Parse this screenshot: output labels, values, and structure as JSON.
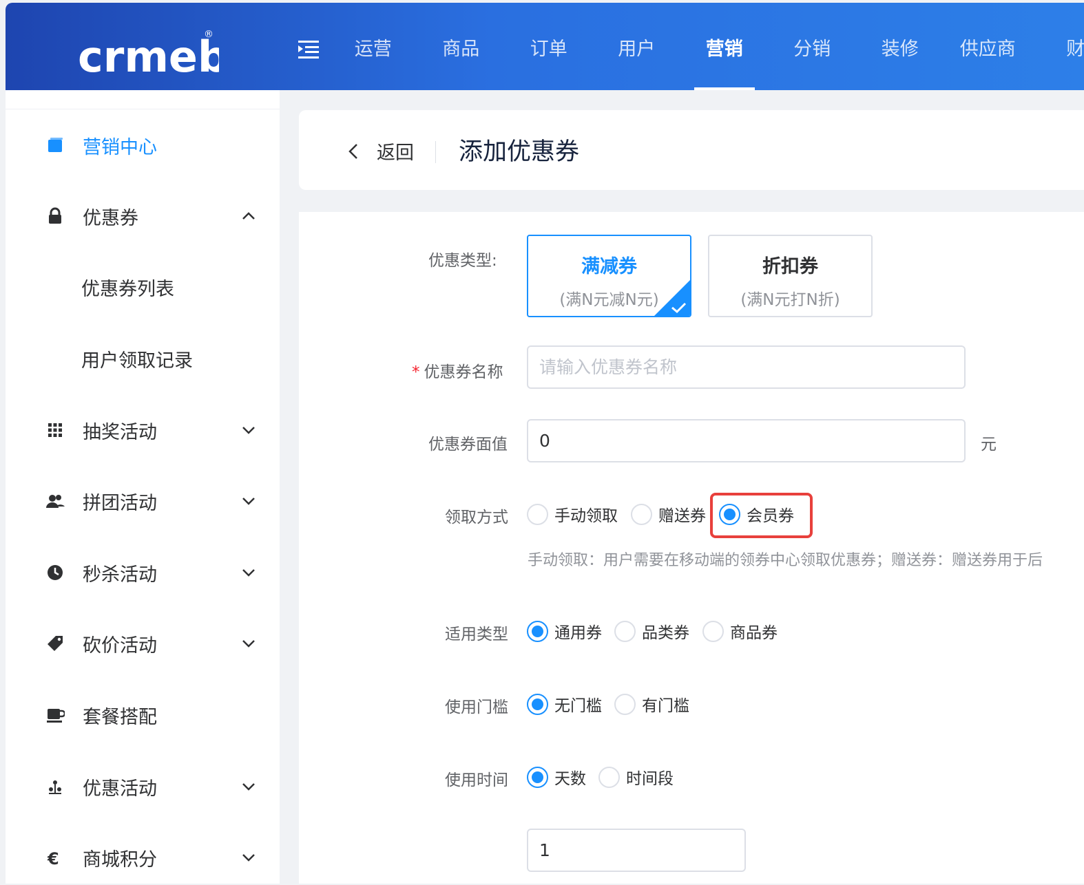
{
  "brand": {
    "logo_text": "crmeb",
    "logo_mark": "®"
  },
  "top_nav": [
    {
      "label": "运营",
      "active": false
    },
    {
      "label": "商品",
      "active": false
    },
    {
      "label": "订单",
      "active": false
    },
    {
      "label": "用户",
      "active": false
    },
    {
      "label": "营销",
      "active": true
    },
    {
      "label": "分销",
      "active": false
    },
    {
      "label": "装修",
      "active": false
    },
    {
      "label": "供应商",
      "active": false
    },
    {
      "label": "财",
      "active": false
    }
  ],
  "sidebar": {
    "items": [
      {
        "label": "营销中心",
        "icon": "square-stack-icon",
        "active": true
      },
      {
        "label": "优惠券",
        "icon": "lock-icon",
        "expanded": true
      },
      {
        "label": "优惠券列表",
        "sub": true
      },
      {
        "label": "用户领取记录",
        "sub": true
      },
      {
        "label": "抽奖活动",
        "icon": "grid-icon"
      },
      {
        "label": "拼团活动",
        "icon": "users-icon"
      },
      {
        "label": "秒杀活动",
        "icon": "clock-icon"
      },
      {
        "label": "砍价活动",
        "icon": "tag-icon"
      },
      {
        "label": "套餐搭配",
        "icon": "cup-icon"
      },
      {
        "label": "优惠活动",
        "icon": "gift-icon"
      },
      {
        "label": "商城积分",
        "icon": "euro-icon"
      }
    ]
  },
  "header": {
    "back_label": "返回",
    "title": "添加优惠券"
  },
  "form": {
    "coupon_type_label": "优惠类型:",
    "coupon_types": [
      {
        "title": "满减券",
        "subtitle": "(满N元减N元)",
        "selected": true
      },
      {
        "title": "折扣券",
        "subtitle": "(满N元打N折)",
        "selected": false
      }
    ],
    "name_label": "优惠券名称",
    "name_required_mark": "*",
    "name_placeholder": "请输入优惠券名称",
    "value_label": "优惠券面值",
    "value": "0",
    "value_unit": "元",
    "receive_label": "领取方式",
    "receive_options": [
      {
        "label": "手动领取",
        "checked": false
      },
      {
        "label": "赠送券",
        "checked": false
      },
      {
        "label": "会员券",
        "checked": true
      }
    ],
    "receive_help": "手动领取：用户需要在移动端的领券中心领取优惠券；赠送券：赠送券用于后",
    "scope_label": "适用类型",
    "scope_options": [
      {
        "label": "通用券",
        "checked": true
      },
      {
        "label": "品类券",
        "checked": false
      },
      {
        "label": "商品券",
        "checked": false
      }
    ],
    "threshold_label": "使用门槛",
    "threshold_options": [
      {
        "label": "无门槛",
        "checked": true
      },
      {
        "label": "有门槛",
        "checked": false
      }
    ],
    "time_label": "使用时间",
    "time_options": [
      {
        "label": "天数",
        "checked": true
      },
      {
        "label": "时间段",
        "checked": false
      }
    ],
    "days_value": "1"
  },
  "colors": {
    "primary": "#1890ff",
    "highlight": "#e8403c",
    "topbar_start": "#1e45b0",
    "topbar_end": "#2d7fe8"
  }
}
